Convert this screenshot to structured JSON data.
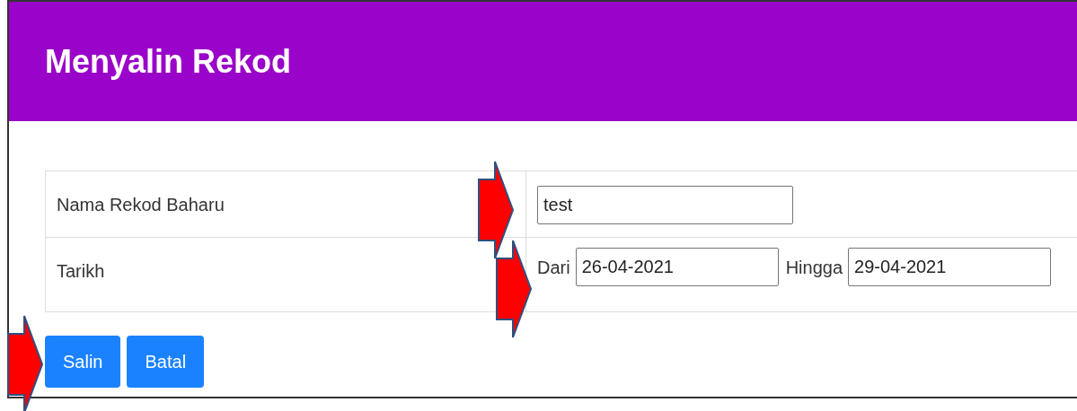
{
  "header": {
    "title": "Menyalin Rekod"
  },
  "form": {
    "rows": [
      {
        "kind": "text",
        "label": "Nama Rekod Baharu",
        "value": "test"
      },
      {
        "kind": "daterange",
        "label": "Tarikh",
        "from_label": "Dari",
        "from_value": "26-04-2021",
        "to_label": "Hingga",
        "to_value": "29-04-2021"
      }
    ]
  },
  "buttons": [
    "Salin",
    "Batal"
  ]
}
